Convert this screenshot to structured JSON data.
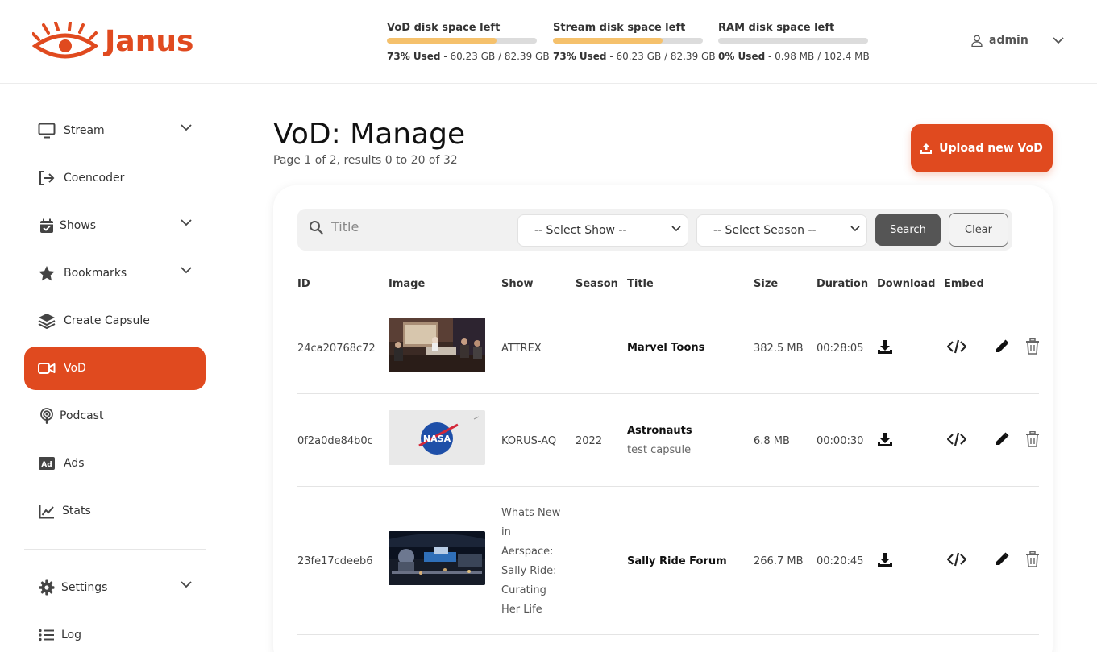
{
  "app": {
    "brand": "Janus",
    "brand_color": "#e04a1f"
  },
  "header": {
    "meters": [
      {
        "title": "VoD disk space left",
        "used_label": "73% Used",
        "detail": " - 60.23 GB / 82.39 GB",
        "fraction": 0.73
      },
      {
        "title": "Stream disk space left",
        "used_label": "73% Used",
        "detail": " - 60.23 GB / 82.39 GB",
        "fraction": 0.73
      },
      {
        "title": "RAM disk space left",
        "used_label": "0% Used",
        "detail": " - 0.98 MB / 102.4 MB",
        "fraction": 0.0
      }
    ],
    "user": {
      "name": "admin"
    }
  },
  "sidebar": {
    "items": [
      {
        "label": "Stream",
        "icon": "monitor-icon",
        "expandable": true
      },
      {
        "label": "Coencoder",
        "icon": "sign-in-icon",
        "expandable": false
      },
      {
        "label": "Shows",
        "icon": "calendar-icon",
        "expandable": true
      },
      {
        "label": "Bookmarks",
        "icon": "star-icon",
        "expandable": true
      },
      {
        "label": "Create Capsule",
        "icon": "layers-icon",
        "expandable": false
      },
      {
        "label": "VoD",
        "icon": "video-camera-icon",
        "expandable": false,
        "active": true
      },
      {
        "label": "Podcast",
        "icon": "podcast-icon",
        "expandable": false
      },
      {
        "label": "Ads",
        "icon": "ad-icon",
        "expandable": false
      },
      {
        "label": "Stats",
        "icon": "chart-line-icon",
        "expandable": false
      },
      {
        "label": "Settings",
        "icon": "gear-icon",
        "expandable": true
      },
      {
        "label": "Log",
        "icon": "list-icon",
        "expandable": false
      }
    ]
  },
  "main": {
    "title": "VoD: Manage",
    "subtitle": "Page 1 of 2, results 0 to 20 of 32",
    "upload_label": "Upload new VoD",
    "filters": {
      "title_placeholder": "Title",
      "show_select": "-- Select Show --",
      "season_select": "-- Select Season --",
      "search_label": "Search",
      "clear_label": "Clear"
    },
    "table": {
      "columns": [
        "ID",
        "Image",
        "Show",
        "Season",
        "Title",
        "Size",
        "Duration",
        "Download",
        "Embed"
      ],
      "rows": [
        {
          "id": "24ca20768c72",
          "show": "ATTREX",
          "season": "",
          "title": "Marvel Toons",
          "subtitle": "",
          "size": "382.5 MB",
          "duration": "00:28:05",
          "image": "panel-discussion-photo"
        },
        {
          "id": "0f2a0de84b0c",
          "show": "KORUS-AQ",
          "season": "2022",
          "title": "Astronauts",
          "subtitle": "test capsule",
          "size": "6.8 MB",
          "duration": "00:00:30",
          "image": "nasa-logo",
          "logo_text": "NASA"
        },
        {
          "id": "23fe17cdeeb6",
          "show": "Whats New in Aerspace: Sally Ride: Curating Her Life",
          "season": "",
          "title": "Sally Ride Forum",
          "subtitle": "",
          "size": "266.7 MB",
          "duration": "00:20:45",
          "image": "museum-hall-photo"
        }
      ]
    }
  }
}
